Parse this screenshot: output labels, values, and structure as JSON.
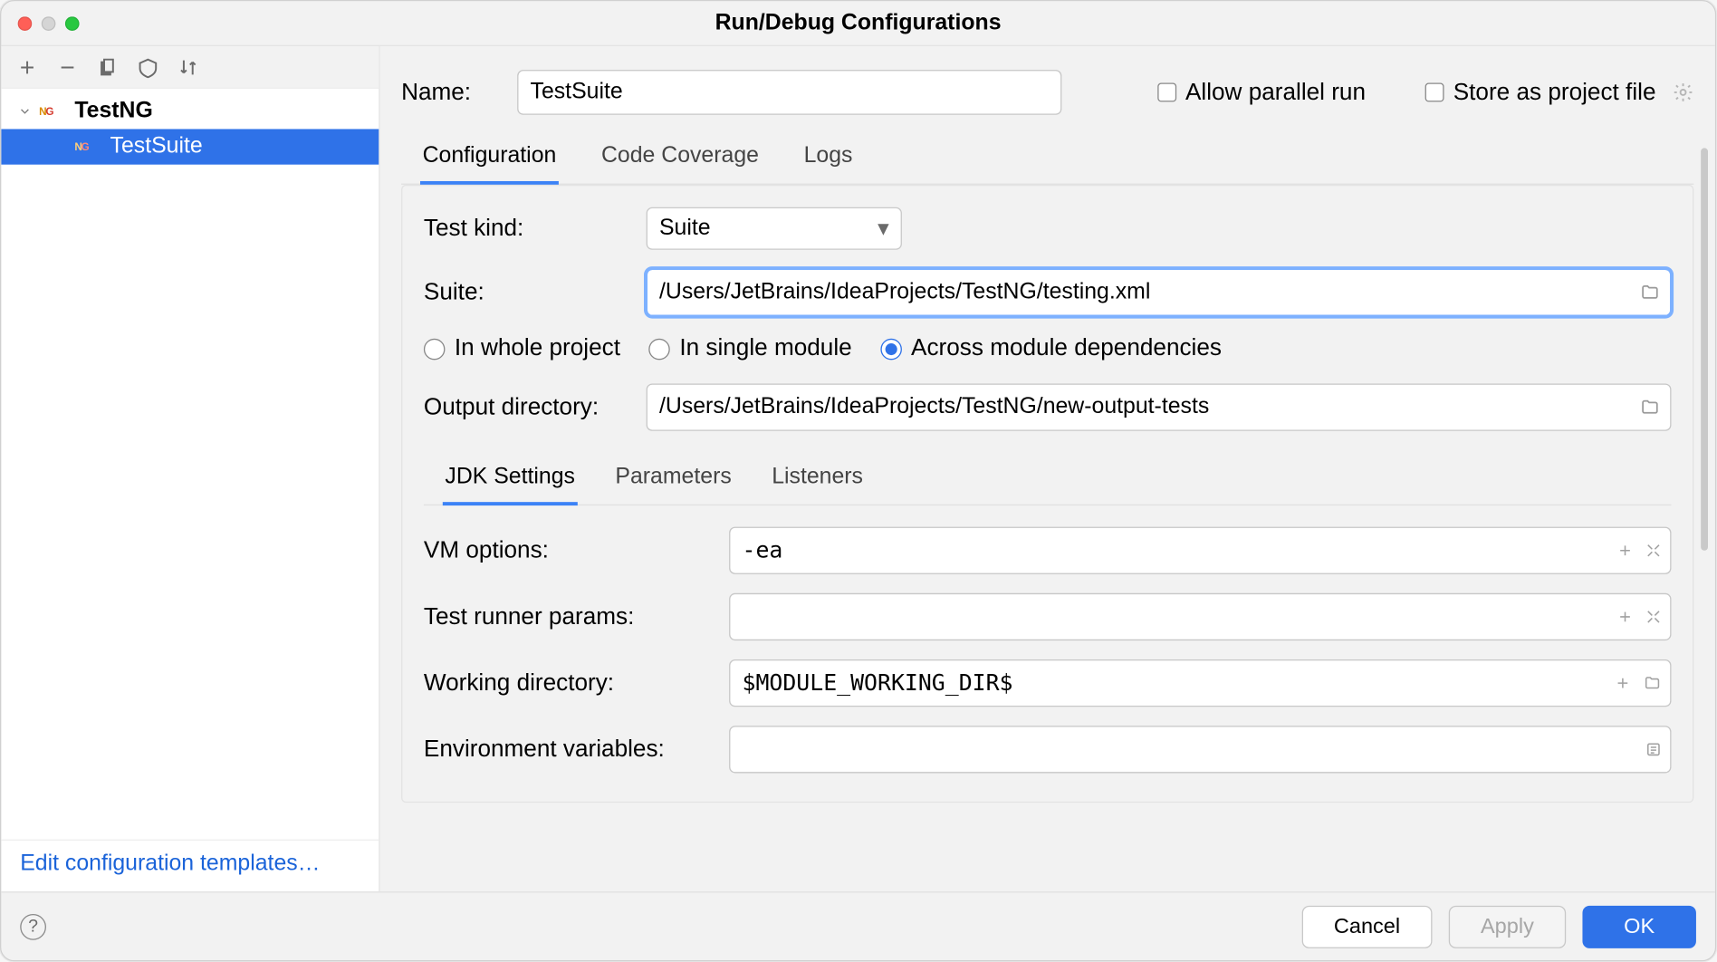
{
  "window": {
    "title": "Run/Debug Configurations"
  },
  "sidebar": {
    "group_label": "TestNG",
    "item_label": "TestSuite",
    "footer_link": "Edit configuration templates…"
  },
  "header": {
    "name_label": "Name:",
    "name_value": "TestSuite",
    "allow_parallel_label": "Allow parallel run",
    "store_project_label": "Store as project file"
  },
  "tabs": {
    "configuration": "Configuration",
    "coverage": "Code Coverage",
    "logs": "Logs"
  },
  "config": {
    "test_kind_label": "Test kind:",
    "test_kind_value": "Suite",
    "suite_label": "Suite:",
    "suite_value": "/Users/JetBrains/IdeaProjects/TestNG/testing.xml",
    "scope": {
      "whole": "In whole project",
      "single": "In single module",
      "across": "Across module dependencies"
    },
    "output_label": "Output directory:",
    "output_value": "/Users/JetBrains/IdeaProjects/TestNG/new-output-tests"
  },
  "sub": {
    "tabs": {
      "jdk": "JDK Settings",
      "params": "Parameters",
      "listeners": "Listeners"
    },
    "vm_label": "VM options:",
    "vm_value": "-ea",
    "runner_label": "Test runner params:",
    "runner_value": "",
    "workdir_label": "Working directory:",
    "workdir_value": "$MODULE_WORKING_DIR$",
    "env_label": "Environment variables:",
    "env_value": ""
  },
  "footer": {
    "cancel": "Cancel",
    "apply": "Apply",
    "ok": "OK"
  }
}
